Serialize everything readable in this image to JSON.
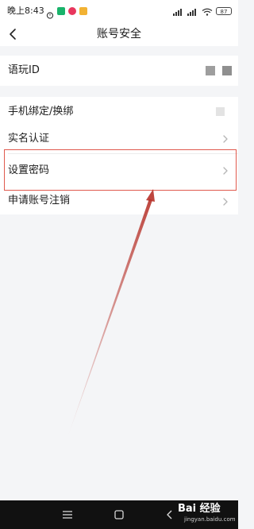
{
  "status_bar": {
    "time": "晚上8:43",
    "battery": "87"
  },
  "header": {
    "title": "账号安全"
  },
  "rows": [
    {
      "label": "语玩ID",
      "trailing": "masked"
    },
    {
      "label": "手机绑定/换绑",
      "trailing": "masked"
    },
    {
      "label": "实名认证",
      "trailing": "chevron"
    },
    {
      "label": "设置密码",
      "trailing": "chevron"
    },
    {
      "label": "申请账号注销",
      "trailing": "chevron"
    }
  ],
  "colors": {
    "highlight": "#e05a4e",
    "background": "#f4f5f7",
    "row_background": "#ffffff"
  },
  "icons": {
    "back": "back-arrow-icon",
    "chevron": "chevron-right-icon",
    "wifi": "wifi-icon",
    "signal": "signal-icon",
    "battery": "battery-icon"
  },
  "watermark": {
    "brand": "Bai 经验",
    "url": "jingyan.baidu.com"
  }
}
